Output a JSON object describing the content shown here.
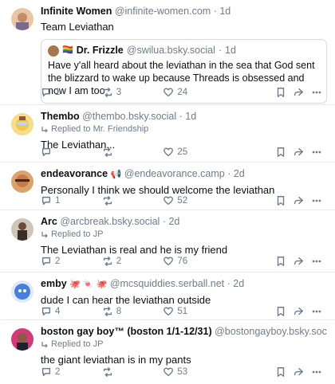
{
  "posts": [
    {
      "name": "Infinite Women",
      "handle": "@infinite-women.com",
      "time": "1d",
      "text": "Team Leviathan",
      "quote": {
        "name": "Dr. Frizzle",
        "handle": "@swilua.bsky.social",
        "time": "1d",
        "text": "Have y'all heard about the leviathan in the sea that God sent the blizzard to wake up because Threads is obsessed and now I am too"
      },
      "replies": "1",
      "reposts": "3",
      "likes": "24"
    },
    {
      "name": "Thembo",
      "handle": "@thembo.bsky.social",
      "time": "1d",
      "reply_to": "Replied to Mr. Friendship",
      "text": "The Leviathan...",
      "replies": "",
      "reposts": "",
      "likes": "25"
    },
    {
      "name": "endeavorance",
      "handle": "@endeavorance.camp",
      "time": "2d",
      "text": "Personally I think we should welcome the leviathan",
      "replies": "1",
      "reposts": "",
      "likes": "52"
    },
    {
      "name": "Arc",
      "handle": "@arcbreak.bsky.social",
      "time": "2d",
      "reply_to": "Replied to JP",
      "text": "The Leviathan is real and he is my friend",
      "replies": "2",
      "reposts": "2",
      "likes": "76"
    },
    {
      "name": "emby",
      "name_emojis": "🐙 🍬 🐙",
      "handle": "@mcsquiddies.serball.net",
      "time": "2d",
      "text": "dude I can hear the leviathan outside",
      "replies": "4",
      "reposts": "8",
      "likes": "51"
    },
    {
      "name": "boston gay boy™ (boston 1/1-12/31)",
      "handle": "@bostongayboy.bsky.social",
      "time": "2d",
      "reply_to": "Replied to JP",
      "text": "the giant leviathan is in my pants",
      "replies": "2",
      "reposts": "",
      "likes": "53"
    }
  ],
  "icons": {
    "reply": "speech-bubble-icon",
    "repost": "repost-arrows-icon",
    "like": "heart-icon",
    "save": "bookmark-icon",
    "share": "share-arrow-icon",
    "more": "ellipsis-icon"
  },
  "colors": {
    "name": "#0b0f14",
    "muted": "#6f7c8b",
    "divider": "#e6e9ed"
  }
}
